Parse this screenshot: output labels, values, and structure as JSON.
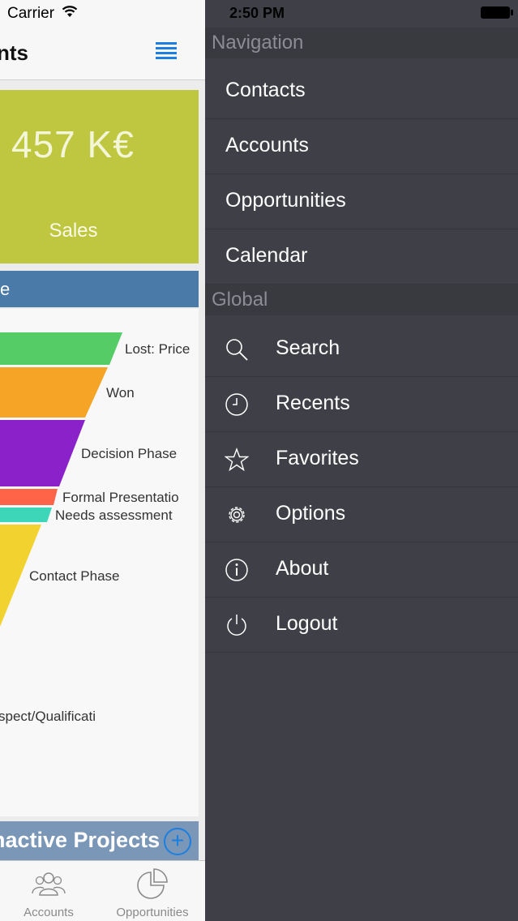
{
  "status_bar": {
    "carrier": "Carrier",
    "time": "2:50 PM"
  },
  "background_view": {
    "title_partial": "nts",
    "sales_tile": {
      "value": "457 K€",
      "label": "Sales",
      "color": "#bfc63f"
    },
    "pipeline_header_partial": "e",
    "funnel": {
      "stages": [
        {
          "label": "Lost: Price",
          "color": "#55cc66"
        },
        {
          "label": "Won",
          "color": "#f5a425"
        },
        {
          "label": "Decision Phase",
          "color": "#8b22c9"
        },
        {
          "label": "Formal Presentatio",
          "color": "#ff6348"
        },
        {
          "label": "Needs assessment",
          "color": "#3dd6b9"
        },
        {
          "label": "Contact Phase",
          "color": "#f2d22e"
        },
        {
          "label": "spect/Qualificati",
          "color": "#f2d22e"
        }
      ]
    },
    "inactive_projects": {
      "label": "nactive Projects",
      "add_symbol": "+"
    },
    "tabs": [
      {
        "label": "Accounts"
      },
      {
        "label": "Opportunities"
      }
    ]
  },
  "drawer": {
    "navigation": {
      "header": "Navigation",
      "items": [
        {
          "label": "Contacts"
        },
        {
          "label": "Accounts"
        },
        {
          "label": "Opportunities"
        },
        {
          "label": "Calendar"
        }
      ]
    },
    "global": {
      "header": "Global",
      "items": [
        {
          "label": "Search",
          "icon": "search-icon"
        },
        {
          "label": "Recents",
          "icon": "clock-icon"
        },
        {
          "label": "Favorites",
          "icon": "star-icon"
        },
        {
          "label": "Options",
          "icon": "gear-icon"
        },
        {
          "label": "About",
          "icon": "info-icon"
        },
        {
          "label": "Logout",
          "icon": "power-icon"
        }
      ]
    }
  }
}
